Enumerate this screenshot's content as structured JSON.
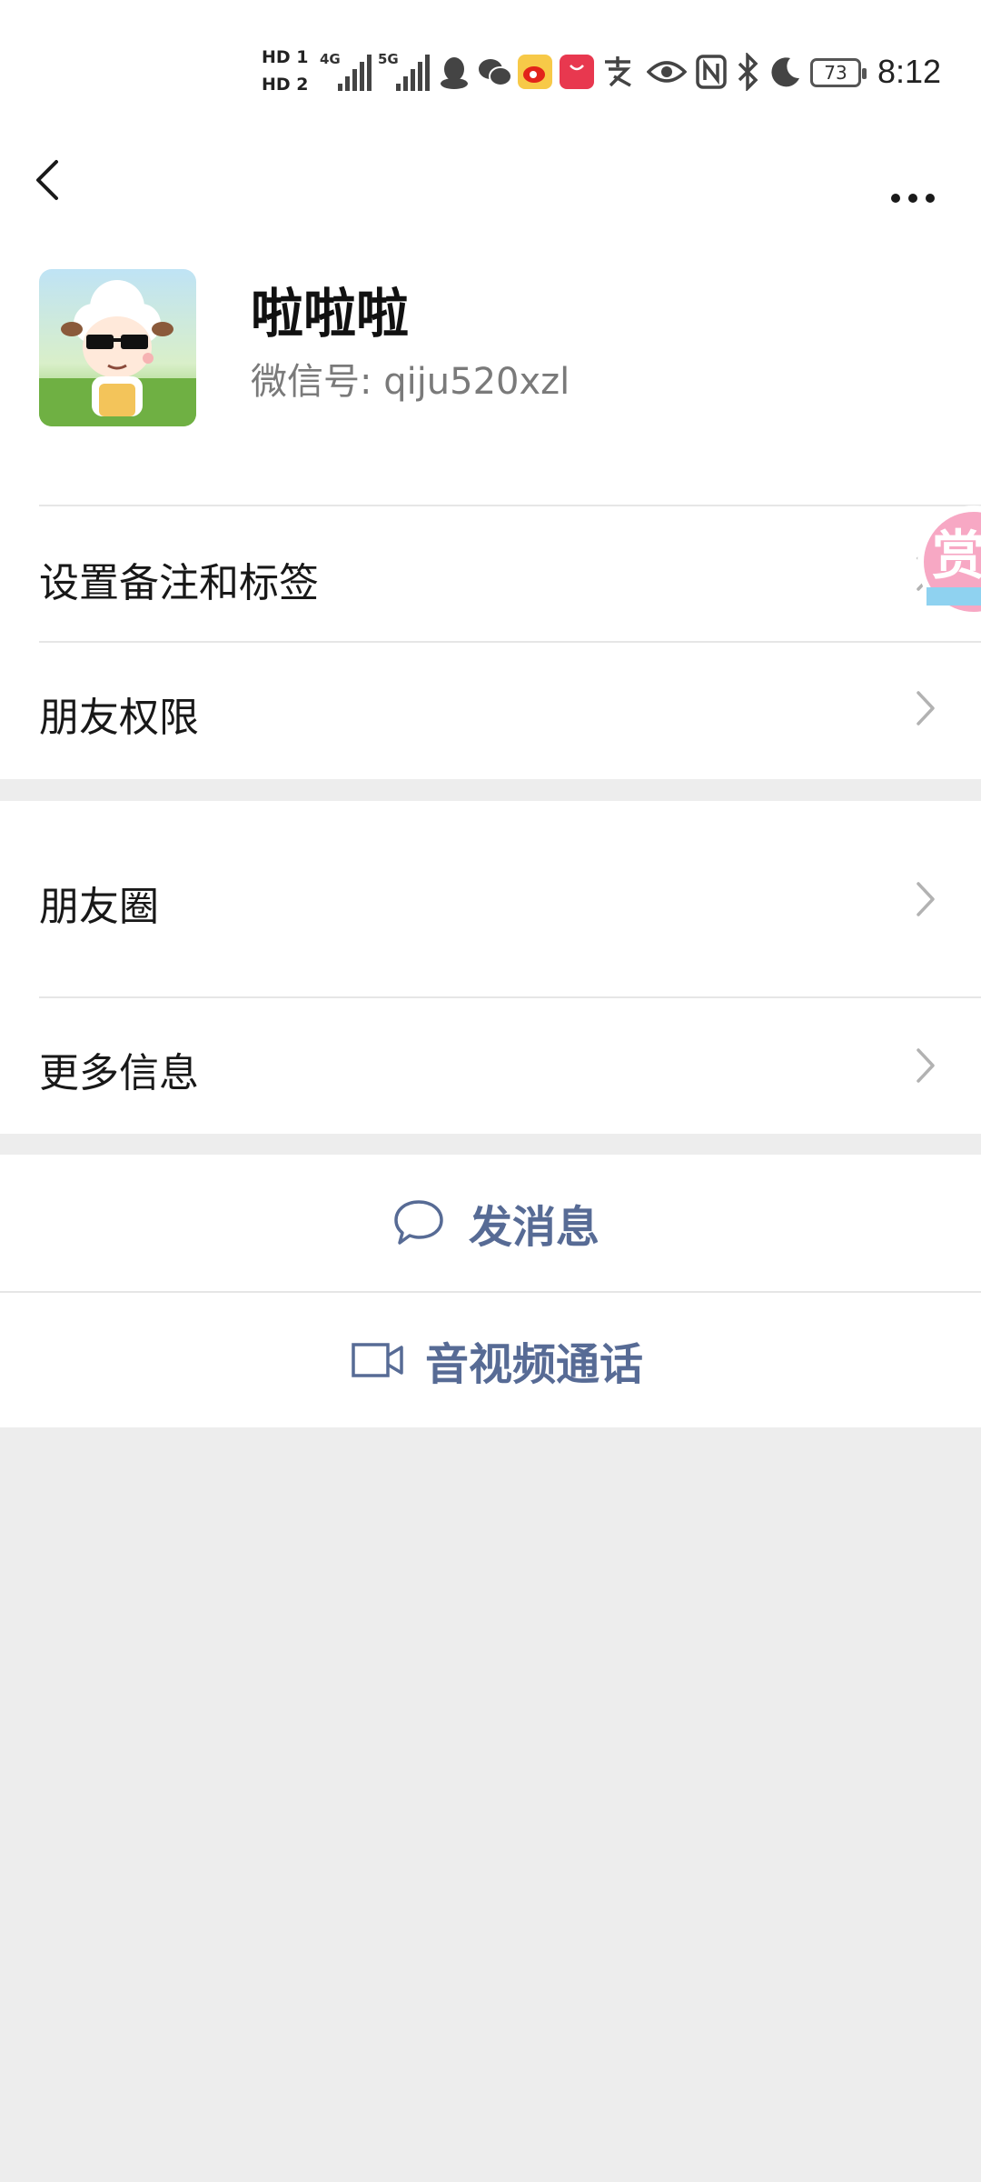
{
  "status_bar": {
    "hd1": "HD 1",
    "hd2": "HD 2",
    "net1": "4G",
    "net2": "5G",
    "battery": "73",
    "time": "8:12"
  },
  "header": {
    "back_icon": "chevron-left-icon",
    "more_icon": "more-horizontal-icon"
  },
  "profile": {
    "nickname": "啦啦啦",
    "wechat_id": "微信号: qiju520xzl"
  },
  "menu": {
    "remark_tags": "设置备注和标签",
    "friend_permissions": "朋友权限",
    "moments": "朋友圈",
    "more_info": "更多信息"
  },
  "actions": {
    "send_message": "发消息",
    "video_call": "音视频通话"
  },
  "floating": {
    "reward_char": "赏"
  },
  "colors": {
    "link_blue": "#576b95",
    "background": "#ededed"
  }
}
